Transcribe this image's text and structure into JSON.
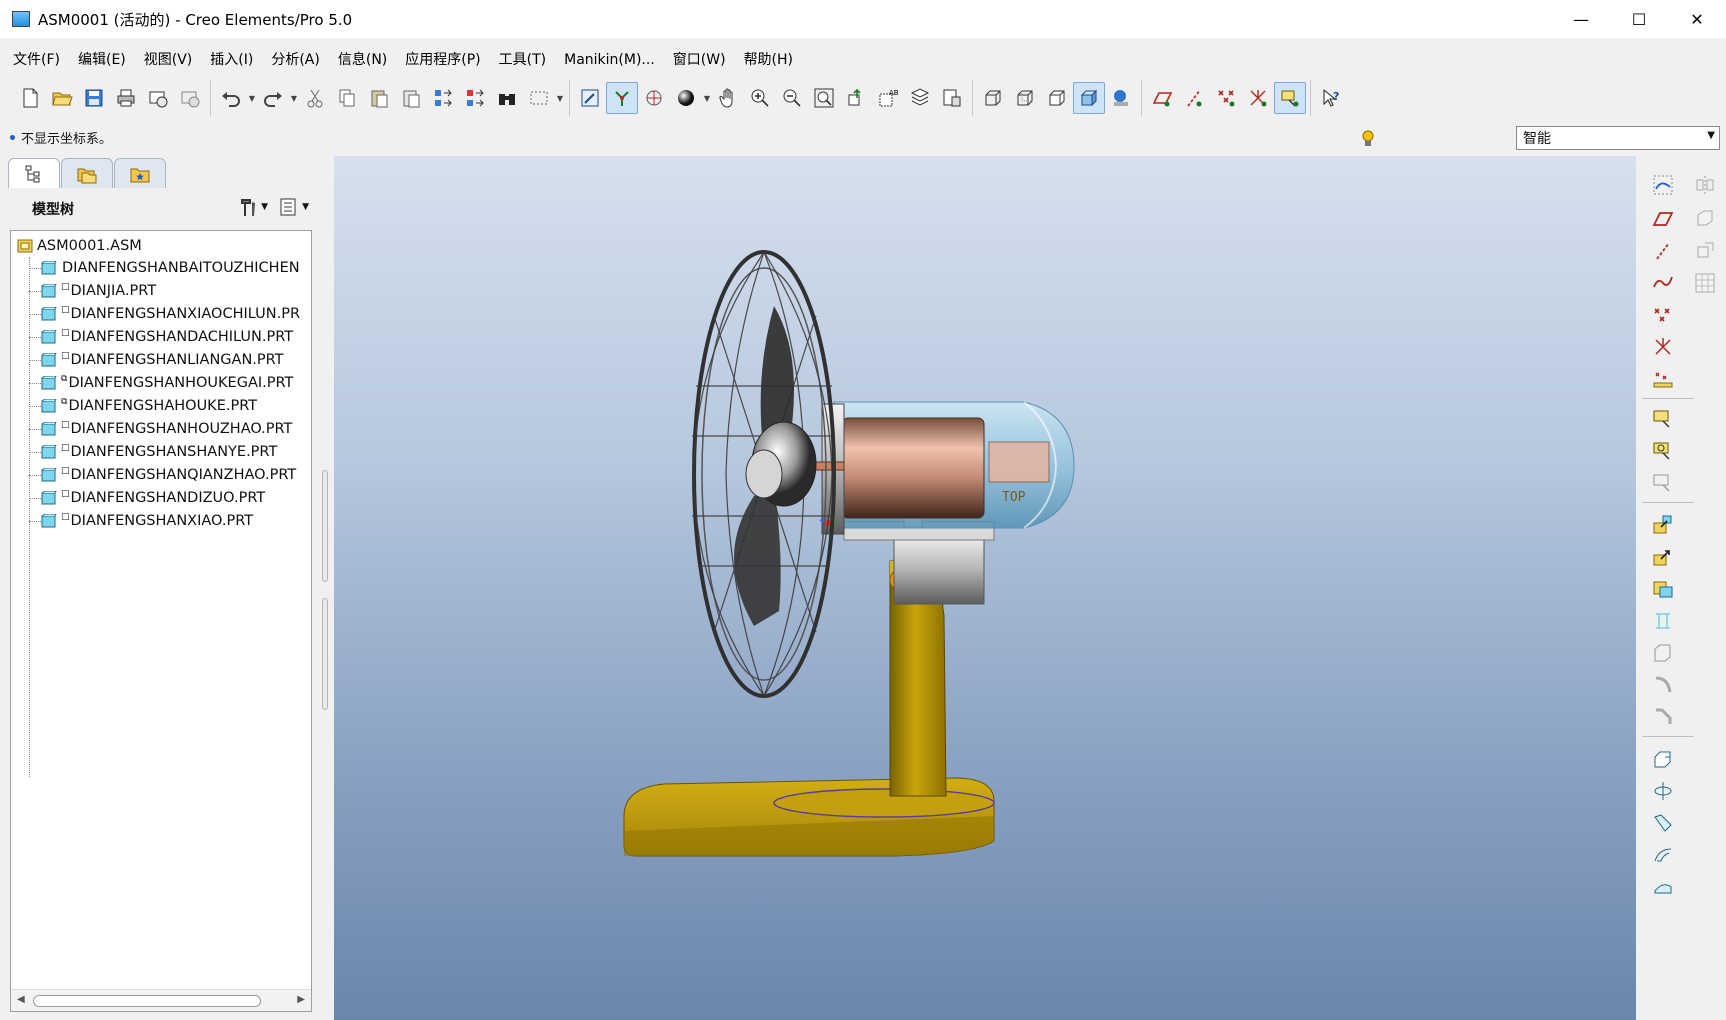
{
  "window": {
    "title": "ASM0001 (活动的) - Creo Elements/Pro 5.0",
    "minimize": "—",
    "maximize": "☐",
    "close": "✕"
  },
  "menu": [
    {
      "label": "文件(F)"
    },
    {
      "label": "编辑(E)"
    },
    {
      "label": "视图(V)"
    },
    {
      "label": "插入(I)"
    },
    {
      "label": "分析(A)"
    },
    {
      "label": "信息(N)"
    },
    {
      "label": "应用程序(P)"
    },
    {
      "label": "工具(T)"
    },
    {
      "label": "Manikin(M)..."
    },
    {
      "label": "窗口(W)"
    },
    {
      "label": "帮助(H)"
    }
  ],
  "message": {
    "text": "不显示坐标系。"
  },
  "filter": {
    "value": "智能"
  },
  "navigator": {
    "panel_title": "模型树"
  },
  "tree": {
    "root": "ASM0001.ASM",
    "items": [
      {
        "name": "DIANFENGSHANBAITOUZHICHEN",
        "mark": ""
      },
      {
        "name": "DIANJIA.PRT",
        "mark": "□"
      },
      {
        "name": "DIANFENGSHANXIAOCHILUN.PR",
        "mark": "□"
      },
      {
        "name": "DIANFENGSHANDACHILUN.PRT",
        "mark": "□"
      },
      {
        "name": "DIANFENGSHANLIANGAN.PRT",
        "mark": "□"
      },
      {
        "name": "DIANFENGSHANHOUKEGAI.PRT",
        "mark": "⧉"
      },
      {
        "name": "DIANFENGSHAHOUKE.PRT",
        "mark": "⧉"
      },
      {
        "name": "DIANFENGSHANHOUZHAO.PRT",
        "mark": "□"
      },
      {
        "name": "DIANFENGSHANSHANYE.PRT",
        "mark": "□"
      },
      {
        "name": "DIANFENGSHANQIANZHAO.PRT",
        "mark": "□"
      },
      {
        "name": "DIANFENGSHANDIZUO.PRT",
        "mark": "□"
      },
      {
        "name": "DIANFENGSHANXIAO.PRT",
        "mark": "□"
      }
    ]
  },
  "viewport": {
    "label": "TOP"
  },
  "colors": {
    "accent": "#1a5fd0",
    "base_gold": "#b8960a",
    "motor_copper": "#c9907a"
  }
}
